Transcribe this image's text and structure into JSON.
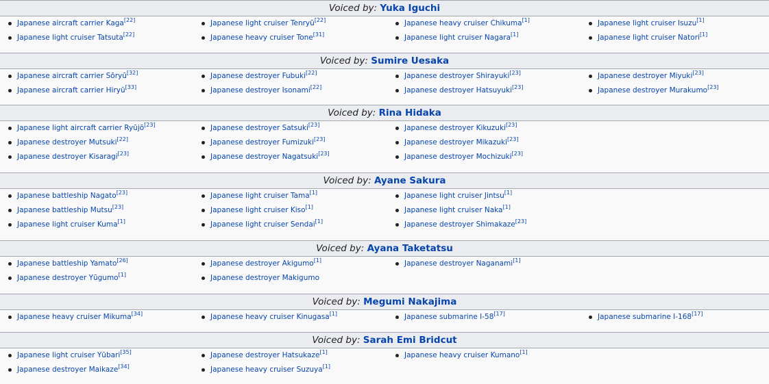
{
  "sections": [
    {
      "voiced_by_label": "Voiced by:",
      "name": "Yuka Iguchi",
      "items": [
        {
          "text": "Japanese aircraft carrier Kaga",
          "ref": "[22]"
        },
        {
          "text": "Japanese light cruiser Tenryū",
          "ref": "[22]"
        },
        {
          "text": "Japanese heavy cruiser Chikuma",
          "ref": "[1]"
        },
        {
          "text": "Japanese light cruiser Isuzu",
          "ref": "[1]"
        },
        {
          "text": "Japanese light cruiser Tatsuta",
          "ref": "[22]"
        },
        {
          "text": "Japanese heavy cruiser Tone",
          "ref": "[31]"
        },
        {
          "text": "Japanese light cruiser Nagara",
          "ref": "[1]"
        },
        {
          "text": "Japanese light cruiser Natori",
          "ref": "[1]"
        }
      ]
    },
    {
      "voiced_by_label": "Voiced by:",
      "name": "Sumire Uesaka",
      "items": [
        {
          "text": "Japanese aircraft carrier Sōryū",
          "ref": "[32]"
        },
        {
          "text": "Japanese destroyer Fubuki",
          "ref": "[22]"
        },
        {
          "text": "Japanese destroyer Shirayuki",
          "ref": "[23]"
        },
        {
          "text": "Japanese destroyer Miyuki",
          "ref": "[23]"
        },
        {
          "text": "Japanese aircraft carrier Hiryū",
          "ref": "[33]"
        },
        {
          "text": "Japanese destroyer Isonami",
          "ref": "[22]"
        },
        {
          "text": "Japanese destroyer Hatsuyuki",
          "ref": "[23]"
        },
        {
          "text": "Japanese destroyer Murakumo",
          "ref": "[23]"
        }
      ]
    },
    {
      "voiced_by_label": "Voiced by:",
      "name": "Rina Hidaka",
      "items": [
        {
          "text": "Japanese light aircraft carrier Ryūjō",
          "ref": "[23]"
        },
        {
          "text": "Japanese destroyer Satsuki",
          "ref": "[23]"
        },
        {
          "text": "Japanese destroyer Kikuzuki",
          "ref": "[23]"
        },
        {
          "text": "Japanese destroyer Mutsuki",
          "ref": "[22]"
        },
        {
          "text": "Japanese destroyer Fumizuki",
          "ref": "[23]"
        },
        {
          "text": "Japanese destroyer Mikazuki",
          "ref": "[23]"
        },
        {
          "text": "Japanese destroyer Kisaragi",
          "ref": "[23]"
        },
        {
          "text": "Japanese destroyer Nagatsuki",
          "ref": "[23]"
        },
        {
          "text": "Japanese destroyer Mochizuki",
          "ref": "[23]"
        }
      ]
    },
    {
      "voiced_by_label": "Voiced by:",
      "name": "Ayane Sakura",
      "items": [
        {
          "text": "Japanese battleship Nagato",
          "ref": "[23]"
        },
        {
          "text": "Japanese light cruiser Tama",
          "ref": "[1]"
        },
        {
          "text": "Japanese light cruiser Jintsu",
          "ref": "[1]"
        },
        {
          "text": "Japanese battleship Mutsu",
          "ref": "[23]"
        },
        {
          "text": "Japanese light cruiser Kiso",
          "ref": "[1]"
        },
        {
          "text": "Japanese light cruiser Naka",
          "ref": "[1]"
        },
        {
          "text": "Japanese light cruiser Kuma",
          "ref": "[1]"
        },
        {
          "text": "Japanese light cruiser Sendai",
          "ref": "[1]"
        },
        {
          "text": "Japanese destroyer Shimakaze",
          "ref": "[23]"
        }
      ]
    },
    {
      "voiced_by_label": "Voiced by:",
      "name": "Ayana Taketatsu",
      "items": [
        {
          "text": "Japanese battleship Yamato",
          "ref": "[26]"
        },
        {
          "text": "Japanese destroyer Akigumo",
          "ref": "[1]"
        },
        {
          "text": "Japanese destroyer Naganami",
          "ref": "[1]"
        },
        {
          "text": "Japanese destroyer Yūgumo",
          "ref": "[1]"
        },
        {
          "text": "Japanese destroyer Makigumo",
          "ref": ""
        }
      ]
    },
    {
      "voiced_by_label": "Voiced by:",
      "name": "Megumi Nakajima",
      "items": [
        {
          "text": "Japanese heavy cruiser Mikuma",
          "ref": "[34]"
        },
        {
          "text": "Japanese heavy cruiser Kinugasa",
          "ref": "[1]"
        },
        {
          "text": "Japanese submarine I-58",
          "ref": "[17]"
        },
        {
          "text": "Japanese submarine I-168",
          "ref": "[17]"
        }
      ]
    },
    {
      "voiced_by_label": "Voiced by:",
      "name": "Sarah Emi Bridcut",
      "items": [
        {
          "text": "Japanese light cruiser Yūbari",
          "ref": "[35]"
        },
        {
          "text": "Japanese destroyer Hatsukaze",
          "ref": "[1]"
        },
        {
          "text": "Japanese heavy cruiser Kumano",
          "ref": "[1]"
        },
        {
          "text": "Japanese destroyer Maikaze",
          "ref": "[34]"
        },
        {
          "text": "Japanese heavy cruiser Suzuya",
          "ref": "[1]"
        }
      ]
    }
  ]
}
